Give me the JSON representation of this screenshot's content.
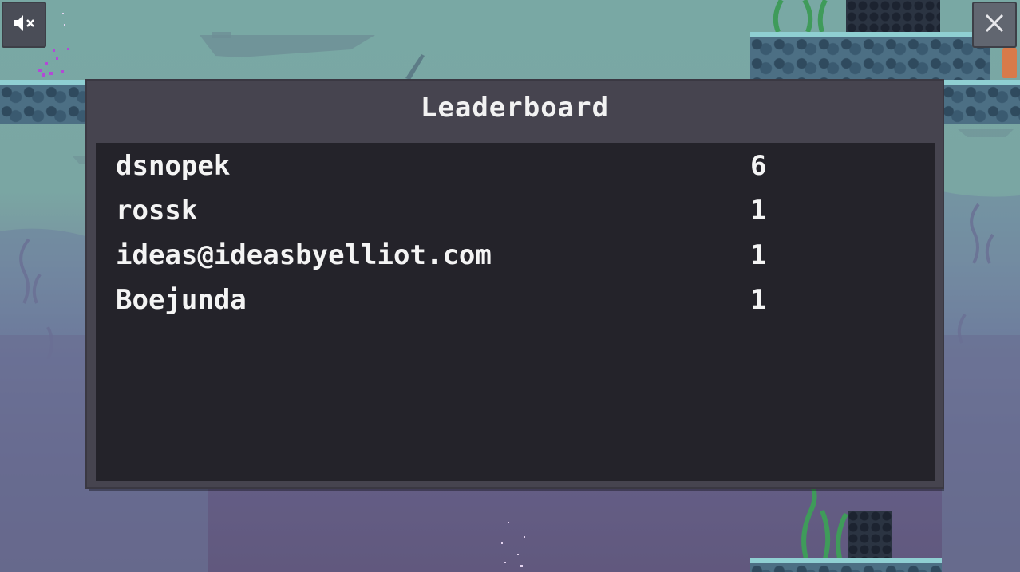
{
  "leaderboard": {
    "title": "Leaderboard",
    "entries": [
      {
        "name": "dsnopek",
        "score": "6"
      },
      {
        "name": "rossk",
        "score": "1"
      },
      {
        "name": "ideas@ideasbyelliot.com",
        "score": "1"
      },
      {
        "name": "Boejunda",
        "score": "1"
      }
    ]
  },
  "controls": {
    "mute_icon": "speaker-muted-icon",
    "close_icon": "close-icon"
  },
  "colors": {
    "panel": "#46444f",
    "list_background": "#24232a",
    "text": "#f4f4f4",
    "sky_top": "#79a8a4",
    "sky_bottom": "#5e5478"
  }
}
